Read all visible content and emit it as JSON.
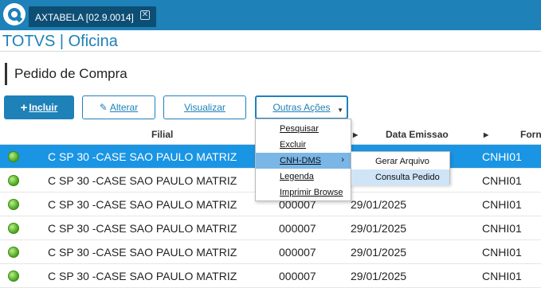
{
  "window": {
    "tab_label": "AXTABELA [02.9.0014]",
    "close_glyph": "✕",
    "app_title": "TOTVS | Oficina"
  },
  "page": {
    "heading": "Pedido de Compra"
  },
  "toolbar": {
    "incluir_icon": "+",
    "incluir_label": "Incluir",
    "alterar_icon": "✎",
    "alterar_label": "Alterar",
    "visualizar_label": "Visualizar",
    "outras_label": "Outras Ações",
    "outras_arrow": "▼"
  },
  "table": {
    "headers": {
      "filial": "Filial",
      "data_emissao": "Data Emissao",
      "forn": "Forn"
    },
    "rows": [
      {
        "filial": "C SP 30 -CASE SAO PAULO MATRIZ",
        "num": "",
        "data": "",
        "forn": "CNHI01",
        "selected": true
      },
      {
        "filial": "C SP 30 -CASE SAO PAULO MATRIZ",
        "num": "",
        "data": "",
        "forn": "CNHI01",
        "selected": false
      },
      {
        "filial": "C SP 30 -CASE SAO PAULO MATRIZ",
        "num": "000007",
        "data": "29/01/2025",
        "forn": "CNHI01",
        "selected": false
      },
      {
        "filial": "C SP 30 -CASE SAO PAULO MATRIZ",
        "num": "000007",
        "data": "29/01/2025",
        "forn": "CNHI01",
        "selected": false
      },
      {
        "filial": "C SP 30 -CASE SAO PAULO MATRIZ",
        "num": "000007",
        "data": "29/01/2025",
        "forn": "CNHI01",
        "selected": false
      },
      {
        "filial": "C SP 30 -CASE SAO PAULO MATRIZ",
        "num": "000007",
        "data": "29/01/2025",
        "forn": "CNHI01",
        "selected": false
      }
    ]
  },
  "menu": {
    "items": [
      "Pesquisar",
      "Excluir",
      "CNH-DMS",
      "Legenda",
      "Imprimir Browse"
    ],
    "submenu_glyph": "›",
    "submenu": [
      "Gerar Arquivo",
      "Consulta Pedido"
    ]
  },
  "colors": {
    "accent": "#1e81b8",
    "selected_row": "#1a95e4",
    "menu_highlight": "#7ab6e6",
    "status_green": "#4aa21c"
  }
}
